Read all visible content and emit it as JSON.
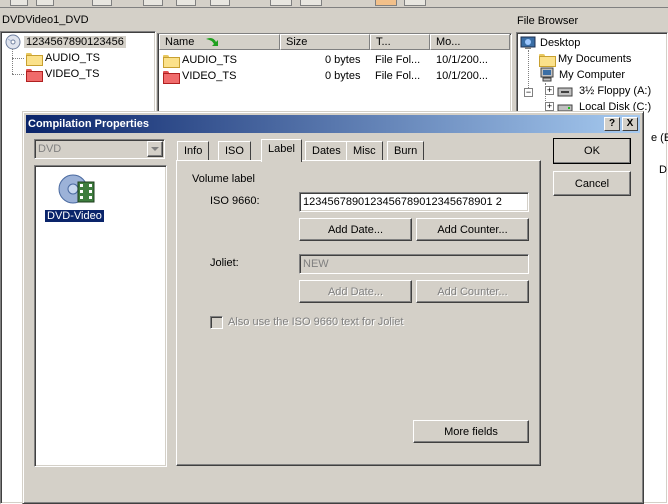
{
  "project": {
    "title": "DVDVideo1_DVD",
    "tree_root": "1234567890123456",
    "tree_children": [
      "AUDIO_TS",
      "VIDEO_TS"
    ]
  },
  "file_list": {
    "columns": [
      "Name",
      "Size",
      "T...",
      "Mo..."
    ],
    "rows": [
      {
        "name": "AUDIO_TS",
        "size": "0 bytes",
        "type": "File Fol...",
        "modified": "10/1/200..."
      },
      {
        "name": "VIDEO_TS",
        "size": "0 bytes",
        "type": "File Fol...",
        "modified": "10/1/200..."
      }
    ]
  },
  "file_browser": {
    "title": "File Browser",
    "items": [
      "Desktop",
      "My Documents",
      "My Computer",
      "3½ Floppy (A:)",
      "Local Disk (C:)"
    ],
    "partial_items": [
      "e (E:)",
      "D"
    ]
  },
  "dialog": {
    "title": "Compilation Properties",
    "help_btn": "?",
    "close_btn": "X",
    "format_select": "DVD",
    "format_icon_label": "DVD-Video",
    "tabs": [
      "Info",
      "ISO",
      "Label",
      "Dates",
      "Misc",
      "Burn"
    ],
    "active_tab": "Label",
    "ok": "OK",
    "cancel": "Cancel",
    "volume_label_group": "Volume label",
    "iso_label": "ISO 9660:",
    "iso_value": "1234567890123456789012345678901 2",
    "add_date": "Add Date...",
    "add_counter": "Add Counter...",
    "joliet_label": "Joliet:",
    "joliet_value": "NEW",
    "also_use": "Also use the ISO 9660 text for Joliet",
    "more_fields": "More fields"
  },
  "colors": {
    "title_start": "#0a246a",
    "title_end": "#a6caf0",
    "face": "#d4d0c8"
  }
}
